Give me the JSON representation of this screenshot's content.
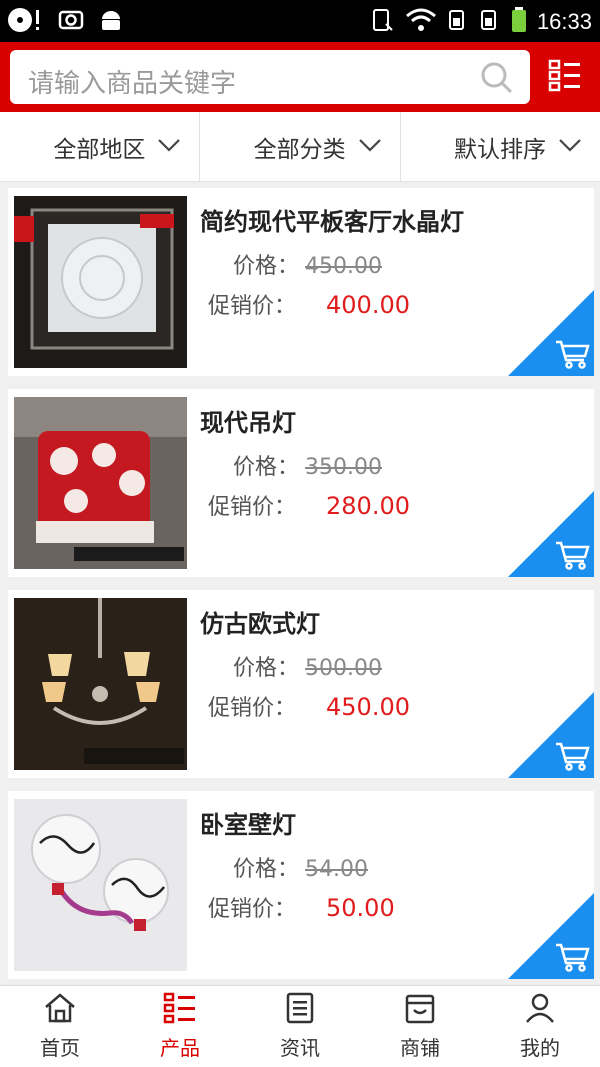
{
  "status": {
    "time": "16:33"
  },
  "search": {
    "placeholder": "请输入商品关键字"
  },
  "filters": [
    {
      "label": "全部地区"
    },
    {
      "label": "全部分类"
    },
    {
      "label": "默认排序"
    }
  ],
  "products": [
    {
      "name": "简约现代平板客厅水晶灯",
      "price_label": "价格：",
      "orig_price": "450.00",
      "promo_label": "促销价：",
      "promo_price": "400.00"
    },
    {
      "name": "现代吊灯",
      "price_label": "价格：",
      "orig_price": "350.00",
      "promo_label": "促销价：",
      "promo_price": "280.00"
    },
    {
      "name": "仿古欧式灯",
      "price_label": "价格：",
      "orig_price": "500.00",
      "promo_label": "促销价：",
      "promo_price": "450.00"
    },
    {
      "name": "卧室壁灯",
      "price_label": "价格：",
      "orig_price": "54.00",
      "promo_label": "促销价：",
      "promo_price": "50.00"
    }
  ],
  "nav": [
    {
      "label": "首页",
      "icon": "home-icon"
    },
    {
      "label": "产品",
      "icon": "product-list-icon"
    },
    {
      "label": "资讯",
      "icon": "news-icon"
    },
    {
      "label": "商铺",
      "icon": "shop-icon"
    },
    {
      "label": "我的",
      "icon": "user-icon"
    }
  ],
  "colors": {
    "brand": "#d90000",
    "price": "#e01c1c",
    "cart": "#1a8ff0"
  }
}
